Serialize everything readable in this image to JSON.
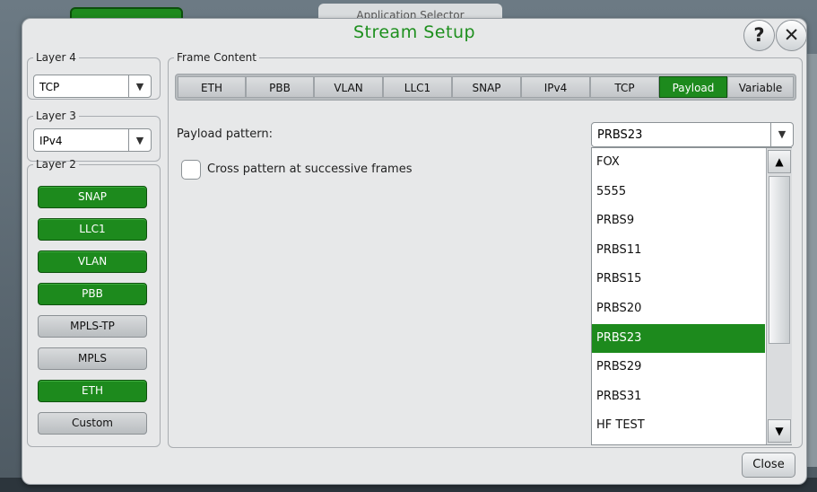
{
  "background": {
    "app_selector_tab": "Application Selector"
  },
  "dialog": {
    "title": "Stream Setup",
    "help_icon": "?",
    "close_icon": "✕",
    "close_label": "Close"
  },
  "layer4": {
    "legend": "Layer 4",
    "value": "TCP"
  },
  "layer3": {
    "legend": "Layer 3",
    "value": "IPv4"
  },
  "layer2": {
    "legend": "Layer 2",
    "buttons": [
      {
        "label": "SNAP",
        "active": true
      },
      {
        "label": "LLC1",
        "active": true
      },
      {
        "label": "VLAN",
        "active": true
      },
      {
        "label": "PBB",
        "active": true
      },
      {
        "label": "MPLS-TP",
        "active": false
      },
      {
        "label": "MPLS",
        "active": false
      },
      {
        "label": "ETH",
        "active": true
      },
      {
        "label": "Custom",
        "active": false
      }
    ]
  },
  "frame_content": {
    "legend": "Frame Content",
    "tabs": [
      "ETH",
      "PBB",
      "VLAN",
      "LLC1",
      "SNAP",
      "IPv4",
      "TCP",
      "Payload",
      "Variable"
    ],
    "active_tab": "Payload",
    "payload_label": "Payload pattern:",
    "payload_value": "PRBS23",
    "cross_label": "Cross pattern at successive frames",
    "cross_checked": false,
    "options": [
      "FOX",
      "5555",
      "PRBS9",
      "PRBS11",
      "PRBS15",
      "PRBS20",
      "PRBS23",
      "PRBS29",
      "PRBS31",
      "HF TEST"
    ],
    "selected_option": "PRBS23"
  },
  "colors": {
    "accent": "#1d8a1d",
    "title": "#1d8f1d"
  },
  "icons": {
    "dropdown": "chevron-down-icon",
    "scroll_up": "arrow-up-icon",
    "scroll_down": "arrow-down-icon"
  }
}
